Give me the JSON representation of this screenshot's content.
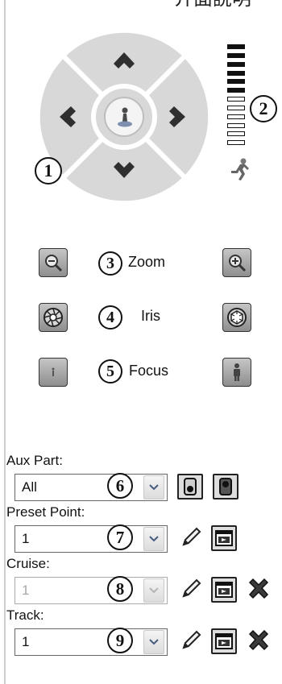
{
  "header": {
    "title_fragment": "介面說明"
  },
  "ptz": {
    "badge": "1",
    "center_icon": "home-person-icon",
    "icons": {
      "up": "arrow-up-icon",
      "down": "arrow-down-icon",
      "left": "arrow-left-icon",
      "right": "arrow-right-icon"
    }
  },
  "speed": {
    "badge": "2",
    "level": 0.5,
    "bars_total": 12,
    "icon": "running-person-icon"
  },
  "controls": [
    {
      "badge": "3",
      "label": "Zoom",
      "left_icon": "zoom-out-icon",
      "right_icon": "zoom-in-icon"
    },
    {
      "badge": "4",
      "label": "Iris",
      "left_icon": "iris-open-icon",
      "right_icon": "iris-close-icon"
    },
    {
      "badge": "5",
      "label": "Focus",
      "left_icon": "focus-near-icon",
      "right_icon": "focus-far-icon"
    }
  ],
  "aux": {
    "label": "Aux Part:",
    "value": "All",
    "badge": "6",
    "disabled": false
  },
  "preset": {
    "label": "Preset Point:",
    "value": "1",
    "badge": "7",
    "disabled": false
  },
  "cruise": {
    "label": "Cruise:",
    "value": "1",
    "badge": "8",
    "disabled": true
  },
  "track": {
    "label": "Track:",
    "value": "1",
    "badge": "9",
    "disabled": false
  },
  "colors": {
    "button_gray": "#a9a9a9",
    "ptz_gray": "#d8d8d8",
    "dark": "#2f2f2f"
  }
}
